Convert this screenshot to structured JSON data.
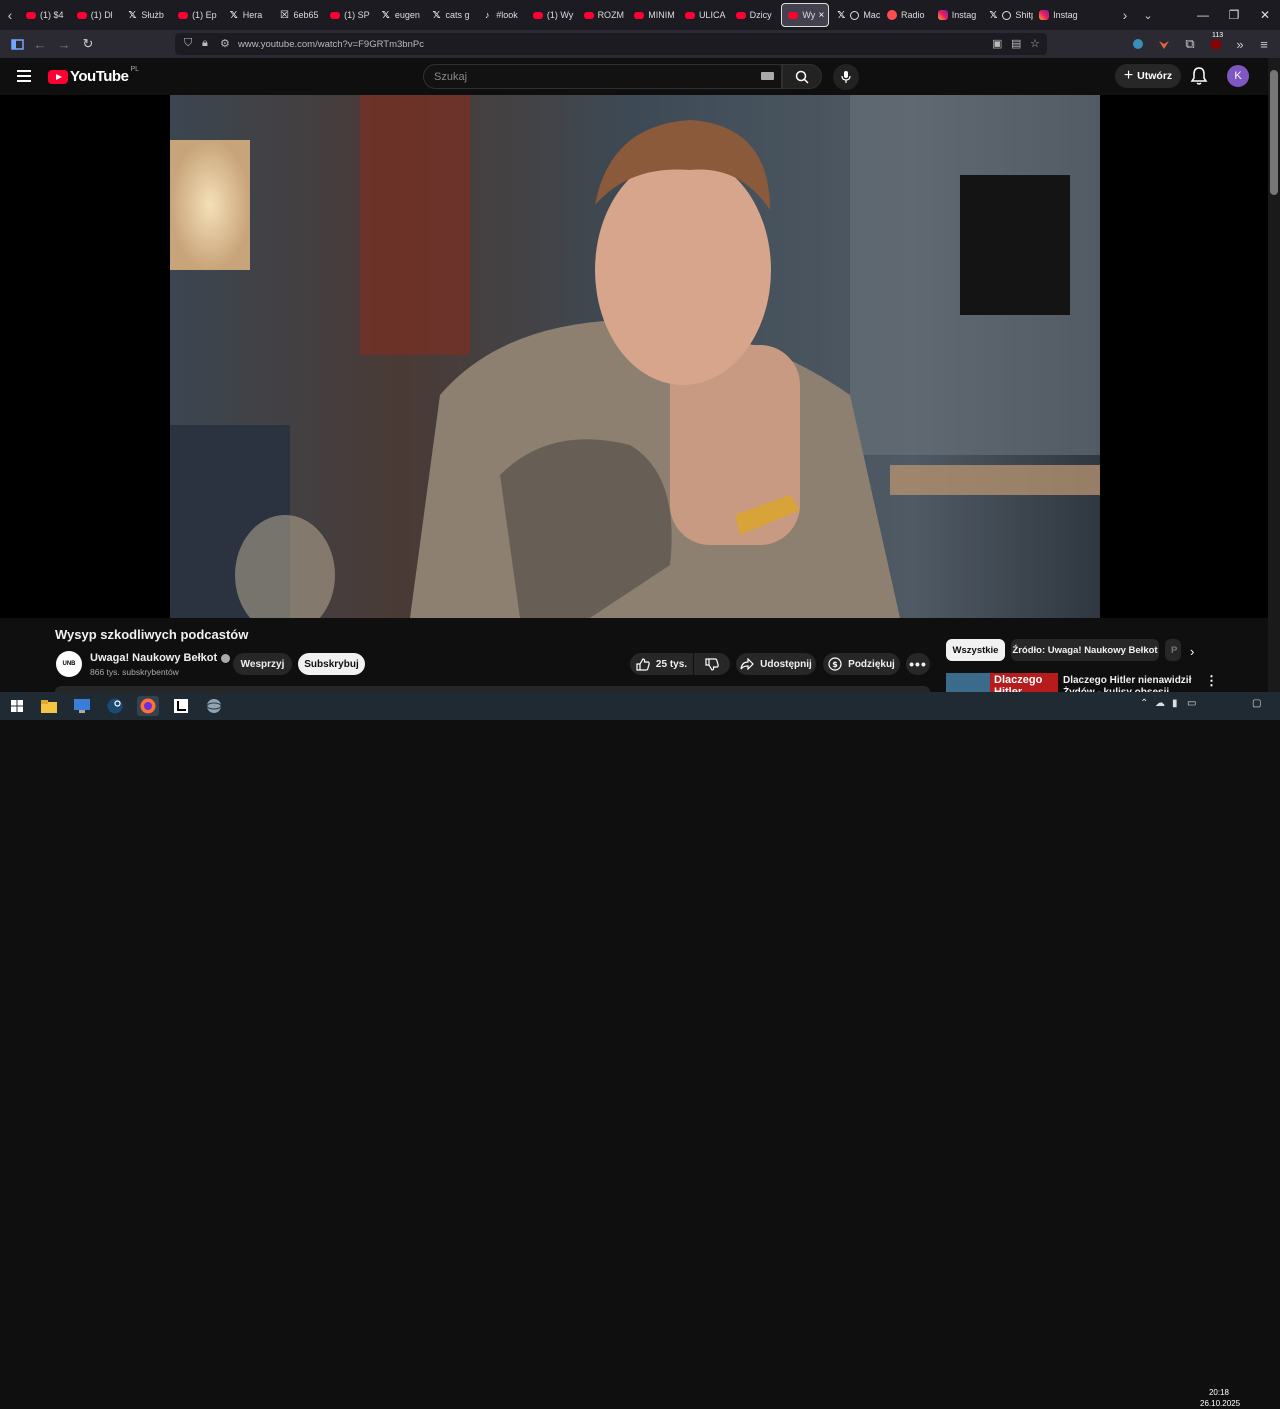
{
  "browser": {
    "tabs": [
      {
        "label": "(1) $4",
        "icon": "youtube"
      },
      {
        "label": "(1) Dl",
        "icon": "youtube"
      },
      {
        "label": "Służb",
        "icon": "x"
      },
      {
        "label": "(1) Ep",
        "icon": "youtube"
      },
      {
        "label": "Hera",
        "icon": "x"
      },
      {
        "label": "6eb65",
        "icon": "x-box"
      },
      {
        "label": "(1) SP",
        "icon": "youtube"
      },
      {
        "label": "eugen",
        "icon": "x"
      },
      {
        "label": "cats g",
        "icon": "x"
      },
      {
        "label": "#look",
        "icon": "tiktok"
      },
      {
        "label": "(1) Wy",
        "icon": "youtube"
      },
      {
        "label": "ROZM",
        "icon": "youtube"
      },
      {
        "label": "MINIM",
        "icon": "youtube"
      },
      {
        "label": "ULICA",
        "icon": "youtube"
      },
      {
        "label": "Dzicy",
        "icon": "youtube"
      },
      {
        "label": "Wy",
        "icon": "youtube",
        "active": true
      },
      {
        "label": "Machi",
        "icon": "x-circle"
      },
      {
        "label": "Radio",
        "icon": "radio"
      },
      {
        "label": "Instag",
        "icon": "instagram"
      },
      {
        "label": "Shitpo",
        "icon": "x-circle"
      },
      {
        "label": "Instag",
        "icon": "instagram"
      }
    ],
    "url": "www.youtube.com/watch?v=F9GRTm3bnPc",
    "extension_badge": "113"
  },
  "youtube": {
    "logo_text": "YouTube",
    "country_code": "PL",
    "search_placeholder": "Szukaj",
    "create_label": "Utwórz",
    "avatar_letter": "K"
  },
  "video": {
    "title": "Wysyp szkodliwych podcastów",
    "channel_name": "Uwaga! Naukowy Bełkot",
    "channel_avatar_text": "UNB",
    "subscribers": "866 tys. subskrybentów",
    "support_label": "Wesprzyj",
    "subscribe_label": "Subskrybuj",
    "likes": "25 tys.",
    "share_label": "Udostępnij",
    "thanks_label": "Podziękuj"
  },
  "sidebar": {
    "chips": [
      "Wszystkie",
      "Źródło: Uwaga! Naukowy Bełkot",
      "P"
    ],
    "rec_thumb_text": "Dlaczego Hitler",
    "rec_title": "Dlaczego Hitler nienawidził Żydów - kulisy obsesji"
  },
  "taskbar": {
    "time": "20:18",
    "date": "26.10.2025"
  }
}
